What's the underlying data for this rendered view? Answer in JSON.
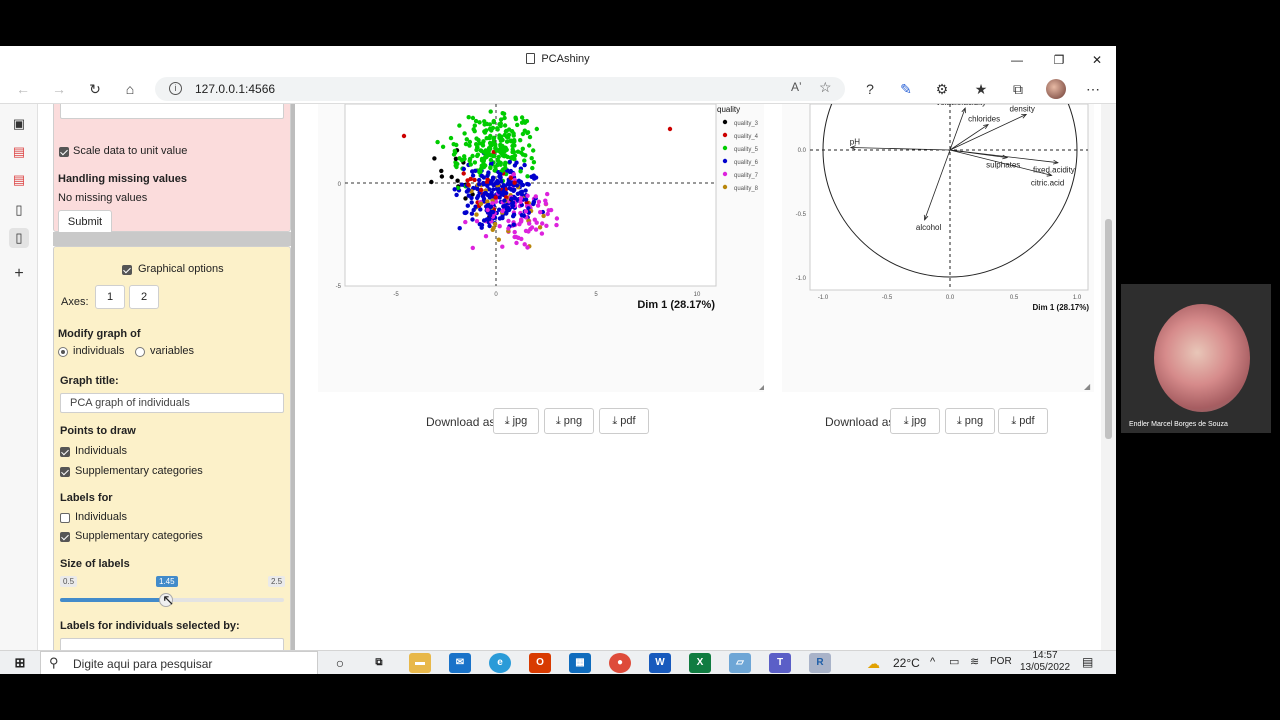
{
  "browser": {
    "tab_title": "PCAshiny",
    "url": "127.0.0.1:4566",
    "reader_glyph": "Aʼ"
  },
  "sidebar": {
    "scale_label": "Scale data to unit value",
    "missing_title": "Handling missing values",
    "missing_text": "No missing values",
    "submit_label": "Submit",
    "graphical_options_label": "Graphical options",
    "axes_label": "Axes:",
    "axis1": "1",
    "axis2": "2",
    "modify_label": "Modify graph of",
    "radio_individuals": "individuals",
    "radio_variables": "variables",
    "graph_title_label": "Graph title:",
    "graph_title_value": "PCA graph of individuals",
    "points_label": "Points to draw",
    "points_individuals": "Individuals",
    "points_supp": "Supplementary categories",
    "labels_for": "Labels for",
    "labels_individuals": "Individuals",
    "labels_supp": "Supplementary categories",
    "size_labels": "Size of labels",
    "slider_min": "0.5",
    "slider_value": "1.45",
    "slider_max": "2.5",
    "slider_fraction": 0.475,
    "labels_selected_by": "Labels for individuals selected by:"
  },
  "ind_plot": {
    "legend_title": "quality",
    "legend": [
      {
        "name": "quality_3",
        "color": "#000000"
      },
      {
        "name": "quality_4",
        "color": "#cc0000"
      },
      {
        "name": "quality_5",
        "color": "#00cc00"
      },
      {
        "name": "quality_6",
        "color": "#0000cc"
      },
      {
        "name": "quality_7",
        "color": "#dd22dd"
      },
      {
        "name": "quality_8",
        "color": "#b8860b"
      }
    ],
    "xlabel": "Dim 1 (28.17%)",
    "x_ticks": [
      "-5",
      "0",
      "5",
      "10"
    ],
    "y_ticks": [
      "0",
      "-5"
    ]
  },
  "var_plot": {
    "xlabel": "Dim 1 (28.17%)",
    "x_ticks": [
      "-1.0",
      "-0.5",
      "0.0",
      "0.5",
      "1.0"
    ],
    "y_ticks": [
      "0.0",
      "-0.5",
      "-1.0"
    ],
    "variables": [
      {
        "name": "volatile.acidity",
        "x": 0.12,
        "y": 0.33
      },
      {
        "name": "density",
        "x": 0.6,
        "y": 0.28
      },
      {
        "name": "chlorides",
        "x": 0.3,
        "y": 0.2
      },
      {
        "name": "pH",
        "x": -0.78,
        "y": 0.02
      },
      {
        "name": "sulphates",
        "x": 0.45,
        "y": -0.06
      },
      {
        "name": "fixed.acidity",
        "x": 0.85,
        "y": -0.1
      },
      {
        "name": "citric.acid",
        "x": 0.8,
        "y": -0.2
      },
      {
        "name": "alcohol",
        "x": -0.2,
        "y": -0.55
      }
    ]
  },
  "downloads": {
    "label": "Download as",
    "jpg": "jpg",
    "png": "png",
    "pdf": "pdf"
  },
  "taskbar": {
    "search_placeholder": "Digite aqui para pesquisar",
    "temperature": "22°C",
    "language": "POR",
    "time": "14:57",
    "date": "13/05/2022"
  },
  "webcam": {
    "name": "Endler Marcel Borges de Souza"
  }
}
